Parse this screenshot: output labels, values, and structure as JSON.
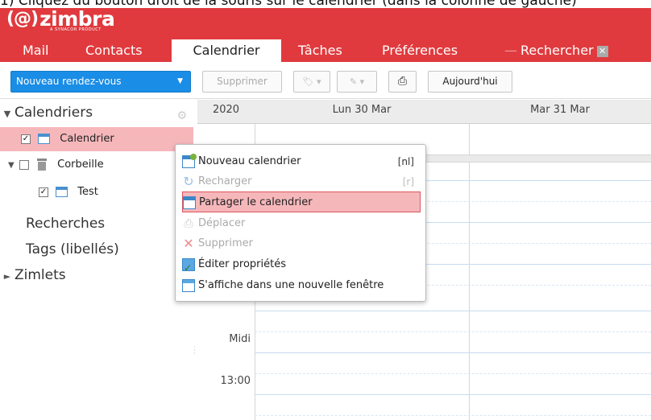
{
  "top_strip_text": "1) Cliquez du bouton droit de la souris sur le calendrier (dans la colonne de gauche)",
  "logo": {
    "mark": "(@)",
    "text": "zimbra",
    "sub": "A SYNACOR PRODUCT"
  },
  "tabs": [
    {
      "label": "Mail"
    },
    {
      "label": "Contacts"
    },
    {
      "label": "Calendrier"
    },
    {
      "label": "Tâches"
    },
    {
      "label": "Préférences"
    },
    {
      "label": "Rechercher"
    }
  ],
  "toolbar": {
    "new_label": "Nouveau rendez-vous",
    "delete_label": "Supprimer",
    "today_label": "Aujourd'hui",
    "print_icon": "print-icon",
    "tag_icon": "tag-icon",
    "tag_icon2": "tag-icon"
  },
  "sidebar": {
    "calendars_header": "Calendriers",
    "items": [
      {
        "label": "Calendrier",
        "checked": "✓"
      },
      {
        "label": "Corbeille",
        "checked": ""
      },
      {
        "label": "Test",
        "checked": "✓"
      }
    ],
    "searches": "Recherches",
    "tags": "Tags (libellés)",
    "zimlets": "Zimlets"
  },
  "calendar": {
    "year": "2020",
    "days": [
      "Lun 30 Mar",
      "Mar 31 Mar"
    ],
    "times": [
      "Midi",
      "13:00"
    ]
  },
  "context_menu": {
    "items": [
      {
        "label": "Nouveau calendrier",
        "shortcut": "[nl]"
      },
      {
        "label": "Recharger",
        "shortcut": "[r]"
      },
      {
        "label": "Partager le calendrier",
        "shortcut": ""
      },
      {
        "label": "Déplacer",
        "shortcut": ""
      },
      {
        "label": "Supprimer",
        "shortcut": ""
      },
      {
        "label": "Éditer propriétés",
        "shortcut": ""
      },
      {
        "label": "S'affiche dans une nouvelle fenêtre",
        "shortcut": ""
      }
    ]
  },
  "colors": {
    "brand": "#e03a3e",
    "accent": "#1a8de6",
    "selection": "#f6b7bb"
  }
}
